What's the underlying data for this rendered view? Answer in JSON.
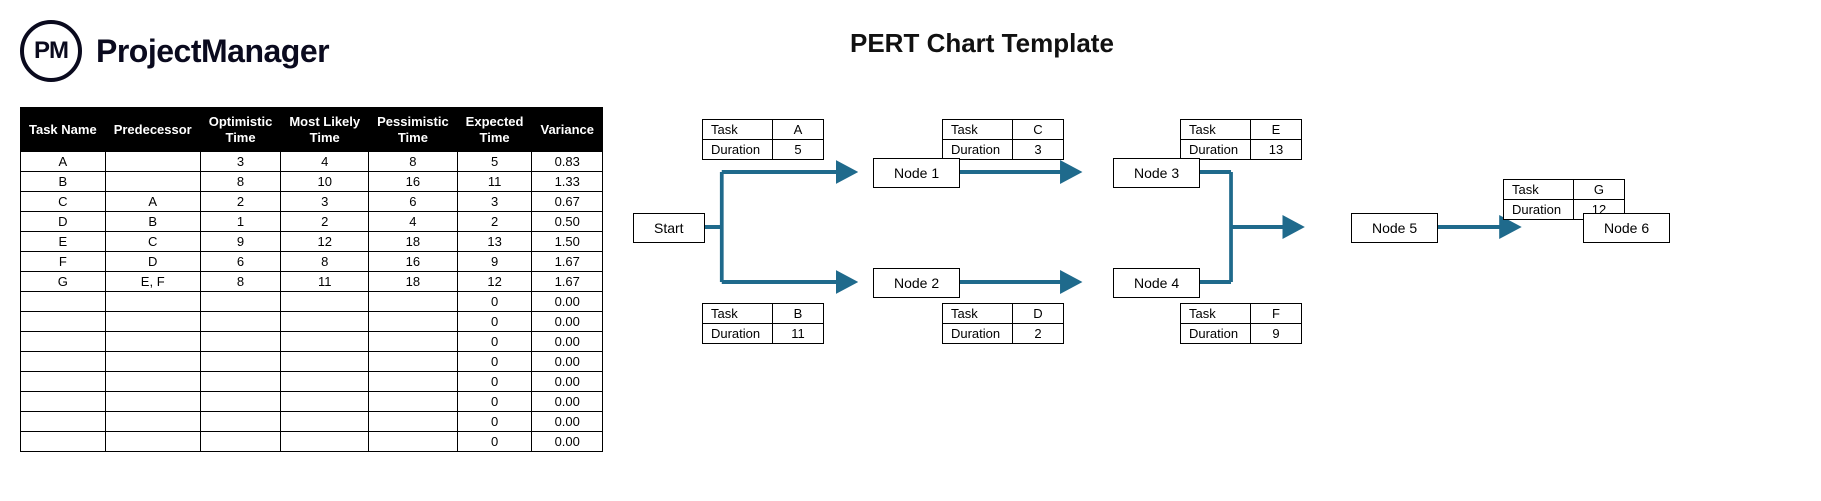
{
  "brand": {
    "logo_text": "PM",
    "name": "ProjectManager"
  },
  "page_title": "PERT Chart Template",
  "table": {
    "headers": [
      "Task Name",
      "Predecessor",
      "Optimistic Time",
      "Most Likely Time",
      "Pessimistic Time",
      "Expected Time",
      "Variance"
    ],
    "rows": [
      [
        "A",
        "",
        "3",
        "4",
        "8",
        "5",
        "0.83"
      ],
      [
        "B",
        "",
        "8",
        "10",
        "16",
        "11",
        "1.33"
      ],
      [
        "C",
        "A",
        "2",
        "3",
        "6",
        "3",
        "0.67"
      ],
      [
        "D",
        "B",
        "1",
        "2",
        "4",
        "2",
        "0.50"
      ],
      [
        "E",
        "C",
        "9",
        "12",
        "18",
        "13",
        "1.50"
      ],
      [
        "F",
        "D",
        "6",
        "8",
        "16",
        "9",
        "1.67"
      ],
      [
        "G",
        "E, F",
        "8",
        "11",
        "18",
        "12",
        "1.67"
      ],
      [
        "",
        "",
        "",
        "",
        "",
        "0",
        "0.00"
      ],
      [
        "",
        "",
        "",
        "",
        "",
        "0",
        "0.00"
      ],
      [
        "",
        "",
        "",
        "",
        "",
        "0",
        "0.00"
      ],
      [
        "",
        "",
        "",
        "",
        "",
        "0",
        "0.00"
      ],
      [
        "",
        "",
        "",
        "",
        "",
        "0",
        "0.00"
      ],
      [
        "",
        "",
        "",
        "",
        "",
        "0",
        "0.00"
      ],
      [
        "",
        "",
        "",
        "",
        "",
        "0",
        "0.00"
      ],
      [
        "",
        "",
        "",
        "",
        "",
        "0",
        "0.00"
      ]
    ]
  },
  "nodes": {
    "start": "Start",
    "n1": "Node 1",
    "n2": "Node 2",
    "n3": "Node 3",
    "n4": "Node 4",
    "n5": "Node 5",
    "n6": "Node 6"
  },
  "info_labels": {
    "task": "Task",
    "duration": "Duration"
  },
  "tasks": {
    "A": {
      "name": "A",
      "duration": "5"
    },
    "B": {
      "name": "B",
      "duration": "11"
    },
    "C": {
      "name": "C",
      "duration": "3"
    },
    "D": {
      "name": "D",
      "duration": "2"
    },
    "E": {
      "name": "E",
      "duration": "13"
    },
    "F": {
      "name": "F",
      "duration": "9"
    },
    "G": {
      "name": "G",
      "duration": "12"
    }
  },
  "chart_data": {
    "type": "pert-network",
    "nodes": [
      "Start",
      "Node 1",
      "Node 2",
      "Node 3",
      "Node 4",
      "Node 5",
      "Node 6"
    ],
    "edges": [
      {
        "from": "Start",
        "to": "Node 1",
        "task": "A",
        "duration": 5
      },
      {
        "from": "Start",
        "to": "Node 2",
        "task": "B",
        "duration": 11
      },
      {
        "from": "Node 1",
        "to": "Node 3",
        "task": "C",
        "duration": 3
      },
      {
        "from": "Node 2",
        "to": "Node 4",
        "task": "D",
        "duration": 2
      },
      {
        "from": "Node 3",
        "to": "Node 5",
        "task": "E",
        "duration": 13
      },
      {
        "from": "Node 4",
        "to": "Node 5",
        "task": "F",
        "duration": 9
      },
      {
        "from": "Node 5",
        "to": "Node 6",
        "task": "G",
        "duration": 12
      }
    ]
  }
}
